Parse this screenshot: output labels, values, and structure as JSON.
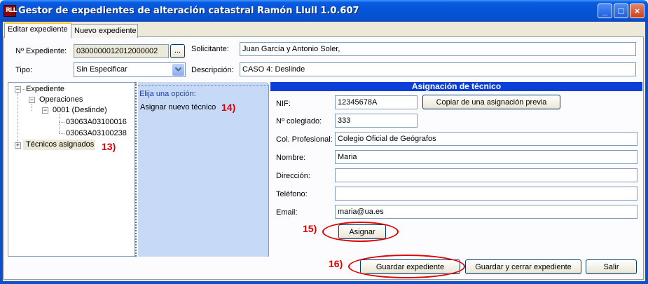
{
  "window": {
    "title": "Gestor de expedientes de alteración catastral Ramón Llull 1.0.607",
    "icon_text": "RLL"
  },
  "tabs": [
    {
      "label": "Editar expediente",
      "active": true
    },
    {
      "label": "Nuevo expediente",
      "active": false
    }
  ],
  "form": {
    "expediente_label": "Nº Expediente:",
    "expediente_value": "0300000012012000002",
    "browse_label": "...",
    "solicitante_label": "Solicitante:",
    "solicitante_value": "Juan García y Antonio Soler,",
    "tipo_label": "Tipo:",
    "tipo_value": "Sin Especificar",
    "descripcion_label": "Descripción:",
    "descripcion_value": "CASO 4: Deslinde"
  },
  "tree": {
    "root": "Expediente",
    "operaciones": "Operaciones",
    "operation": "0001 (Deslinde)",
    "parcels": [
      "03063A03100016",
      "03063A03100238"
    ],
    "tecnicos": "Técnicos asignados",
    "expand_symbol": "+",
    "collapse_symbol": "−"
  },
  "options": {
    "header": "Elija una opción:",
    "items": [
      "Asignar nuevo técnico"
    ]
  },
  "tecnico": {
    "header": "Asignación de técnico",
    "nif_label": "NIF:",
    "nif_value": "12345678A",
    "copy_button": "Copiar de una asignación previa",
    "colegiado_label": "Nº colegiado:",
    "colegiado_value": "333",
    "col_prof_label": "Col. Profesional:",
    "col_prof_value": "Colegio Oficial de Geógrafos",
    "nombre_label": "Nombre:",
    "nombre_value": "Maria",
    "direccion_label": "Dirección:",
    "direccion_value": "",
    "telefono_label": "Teléfono:",
    "telefono_value": "",
    "email_label": "Email:",
    "email_value": "maria@ua.es",
    "assign_button": "Asignar"
  },
  "footer": {
    "save": "Guardar expediente",
    "save_close": "Guardar y cerrar expediente",
    "exit": "Salir"
  },
  "annotations": {
    "a13": "13)",
    "a14": "14)",
    "a15": "15)",
    "a16": "16)"
  },
  "colors": {
    "titlebar": "#0654d8",
    "annotation": "#e00000",
    "section_header": "#0a3fd8",
    "options_panel": "#c6d9f7"
  },
  "caption_buttons": {
    "minimize": "_",
    "maximize": "□",
    "close": "×"
  }
}
